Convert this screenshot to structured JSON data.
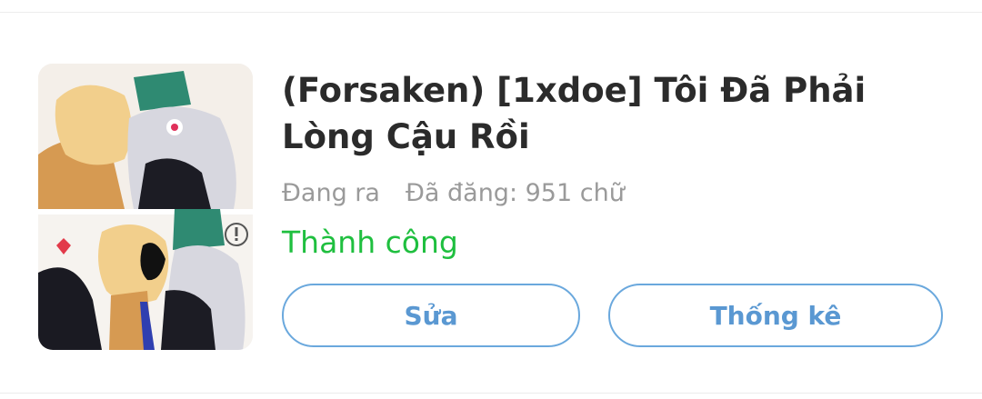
{
  "story": {
    "title": "(Forsaken) [1xdoe] Tôi Đã Phải Lòng Cậu Rồi",
    "cover_icon": "story-cover-illustration",
    "publication_status": "Đang ra",
    "word_count_label": "Đã đăng: 951 chữ",
    "result_status": "Thành công"
  },
  "actions": {
    "edit_label": "Sửa",
    "stats_label": "Thống kê"
  },
  "colors": {
    "title": "#2b2b2b",
    "meta": "#9a9a9a",
    "success": "#1fbf3f",
    "button_border": "#6aa8dd",
    "button_text": "#5a98d2"
  }
}
